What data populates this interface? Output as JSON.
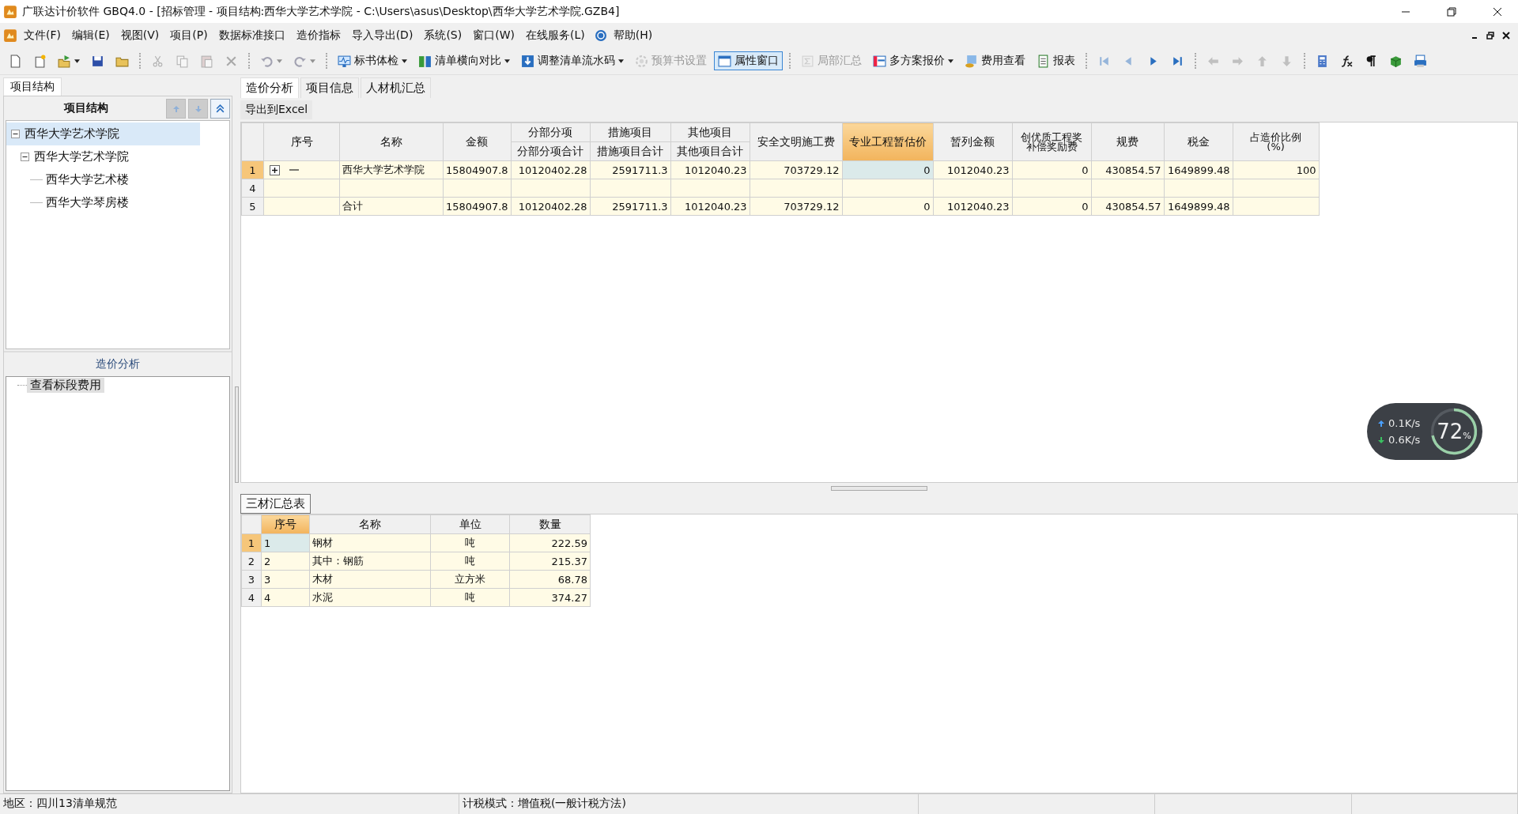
{
  "window": {
    "title": "广联达计价软件 GBQ4.0 - [招标管理 - 项目结构:西华大学艺术学院 - C:\\Users\\asus\\Desktop\\西华大学艺术学院.GZB4]"
  },
  "menu": [
    {
      "label": "文件(F)"
    },
    {
      "label": "编辑(E)"
    },
    {
      "label": "视图(V)"
    },
    {
      "label": "项目(P)"
    },
    {
      "label": "数据标准接口"
    },
    {
      "label": "造价指标"
    },
    {
      "label": "导入导出(D)"
    },
    {
      "label": "系统(S)"
    },
    {
      "label": "窗口(W)"
    },
    {
      "label": "在线服务(L)"
    },
    {
      "label": "帮助(H)",
      "help": true
    }
  ],
  "toolbar": [
    {
      "kind": "icon",
      "disabled": false,
      "dropdown": false
    },
    {
      "kind": "icon",
      "disabled": false,
      "dropdown": false
    },
    {
      "kind": "icon",
      "disabled": false,
      "dropdown": true
    },
    {
      "kind": "icon",
      "disabled": false,
      "dropdown": false
    },
    {
      "kind": "icon",
      "disabled": false,
      "dropdown": false
    },
    {
      "kind": "separator"
    },
    {
      "kind": "icon",
      "disabled": true,
      "dropdown": false
    },
    {
      "kind": "icon",
      "disabled": true,
      "dropdown": false
    },
    {
      "kind": "icon",
      "disabled": true,
      "dropdown": false
    },
    {
      "kind": "icon",
      "disabled": true,
      "dropdown": false
    },
    {
      "kind": "separator"
    },
    {
      "kind": "icon",
      "disabled": true,
      "dropdown": true
    },
    {
      "kind": "icon",
      "disabled": true,
      "dropdown": true
    },
    {
      "kind": "separator"
    },
    {
      "kind": "button",
      "label": "标书体检",
      "disabled": false,
      "pressed": false,
      "dropdown": true
    },
    {
      "kind": "button",
      "label": "清单横向对比",
      "disabled": false,
      "pressed": false,
      "dropdown": true
    },
    {
      "kind": "button",
      "label": "调整清单流水码",
      "disabled": false,
      "pressed": false,
      "dropdown": true
    },
    {
      "kind": "button",
      "label": "预算书设置",
      "disabled": true,
      "pressed": false,
      "dropdown": false
    },
    {
      "kind": "button",
      "label": "属性窗口",
      "disabled": false,
      "pressed": true,
      "dropdown": false
    },
    {
      "kind": "separator"
    },
    {
      "kind": "button",
      "label": "局部汇总",
      "disabled": true,
      "pressed": false,
      "dropdown": false
    },
    {
      "kind": "button",
      "label": "多方案报价",
      "disabled": false,
      "pressed": false,
      "dropdown": true
    },
    {
      "kind": "button",
      "label": "费用查看",
      "disabled": false,
      "pressed": false,
      "dropdown": false
    },
    {
      "kind": "button",
      "label": "报表",
      "disabled": false,
      "pressed": false,
      "dropdown": false
    },
    {
      "kind": "separator"
    },
    {
      "kind": "icon",
      "disabled": true,
      "dropdown": false
    },
    {
      "kind": "icon",
      "disabled": true,
      "dropdown": false
    },
    {
      "kind": "icon",
      "disabled": false,
      "dropdown": false
    },
    {
      "kind": "icon",
      "disabled": false,
      "dropdown": false
    },
    {
      "kind": "separator"
    },
    {
      "kind": "icon",
      "disabled": true,
      "dropdown": false
    },
    {
      "kind": "icon",
      "disabled": true,
      "dropdown": false
    },
    {
      "kind": "icon",
      "disabled": true,
      "dropdown": false
    },
    {
      "kind": "icon",
      "disabled": true,
      "dropdown": false
    },
    {
      "kind": "separator"
    },
    {
      "kind": "icon",
      "disabled": false,
      "dropdown": false
    },
    {
      "kind": "icon",
      "disabled": false,
      "dropdown": false
    },
    {
      "kind": "icon",
      "disabled": false,
      "dropdown": false
    },
    {
      "kind": "icon",
      "disabled": false,
      "dropdown": false
    },
    {
      "kind": "icon",
      "disabled": false,
      "dropdown": false
    }
  ],
  "sidebar": {
    "tab": "项目结构",
    "header": "项目结构",
    "header_buttons": [
      {
        "disabled": true
      },
      {
        "disabled": true
      },
      {
        "disabled": false
      }
    ],
    "tree": [
      {
        "label": "西华大学艺术学院",
        "selected": true,
        "expanded": true,
        "children": [
          {
            "label": "西华大学艺术学院",
            "selected": false,
            "expanded": true,
            "children": [
              {
                "label": "西华大学艺术楼",
                "selected": false
              },
              {
                "label": "西华大学琴房楼",
                "selected": false
              }
            ]
          }
        ]
      }
    ],
    "analysis_header": "造价分析",
    "analysis_items": [
      {
        "label": "查看标段费用",
        "selected": true
      }
    ]
  },
  "tabs": [
    {
      "label": "造价分析",
      "selected": true
    },
    {
      "label": "项目信息",
      "selected": false
    },
    {
      "label": "人材机汇总",
      "selected": false
    }
  ],
  "export_button": "导出到Excel",
  "table": {
    "columns": [
      {
        "label": "序号",
        "selected": false
      },
      {
        "label": "名称",
        "selected": false
      },
      {
        "label": "金额",
        "selected": false
      },
      {
        "group": "分部分项",
        "label": "分部分项合计",
        "selected": false
      },
      {
        "group": "措施项目",
        "label": "措施项目合计",
        "selected": false
      },
      {
        "group": "其他项目",
        "label": "其他项目合计",
        "selected": false
      },
      {
        "label": "安全文明施工费",
        "selected": false
      },
      {
        "label": "专业工程暂估价",
        "selected": true
      },
      {
        "label": "暂列金额",
        "selected": false
      },
      {
        "label": "创优质工程奖补偿奖励费",
        "selected": false
      },
      {
        "label": "规费",
        "selected": false
      },
      {
        "label": "税金",
        "selected": false
      },
      {
        "label": "占造价比例(%)",
        "selected": false
      }
    ],
    "rows": [
      {
        "number": "1",
        "selected": true,
        "expandable": true,
        "expanded": false,
        "cells": [
          "",
          "西华大学艺术学院",
          "15804907.8",
          "10120402.28",
          "2591711.3",
          "1012040.23",
          "703729.12",
          "0",
          "1012040.23",
          "0",
          "430854.57",
          "1649899.48",
          "100"
        ]
      },
      {
        "number": "4",
        "selected": false,
        "cells": []
      },
      {
        "number": "5",
        "selected": false,
        "cells": [
          "",
          "合计",
          "15804907.8",
          "10120402.28",
          "2591711.3",
          "1012040.23",
          "703729.12",
          "0",
          "1012040.23",
          "0",
          "430854.57",
          "1649899.48"
        ]
      }
    ]
  },
  "bottom_tab": {
    "label": "三材汇总表",
    "selected": true
  },
  "materials": {
    "columns": [
      {
        "label": "序号",
        "selected": true
      },
      {
        "label": "名称",
        "selected": false
      },
      {
        "label": "单位",
        "selected": false
      },
      {
        "label": "数量",
        "selected": false
      }
    ],
    "rows": [
      {
        "number": "1",
        "selected": true,
        "cells": [
          "1",
          "钢材",
          "吨",
          "222.59"
        ]
      },
      {
        "number": "2",
        "selected": false,
        "cells": [
          "2",
          "其中：钢筋",
          "吨",
          "215.37"
        ]
      },
      {
        "number": "3",
        "selected": false,
        "cells": [
          "3",
          "木材",
          "立方米",
          "68.78"
        ]
      },
      {
        "number": "4",
        "selected": false,
        "cells": [
          "4",
          "水泥",
          "吨",
          "374.27"
        ]
      }
    ]
  },
  "network_widget": {
    "upload": "0.1K/s",
    "download": "0.6K/s",
    "value": "72",
    "unit": "%"
  },
  "status_bar": [
    {
      "text": "地区：四川13清单规范"
    },
    {
      "text": "计税模式：增值税(一般计税方法)"
    }
  ]
}
